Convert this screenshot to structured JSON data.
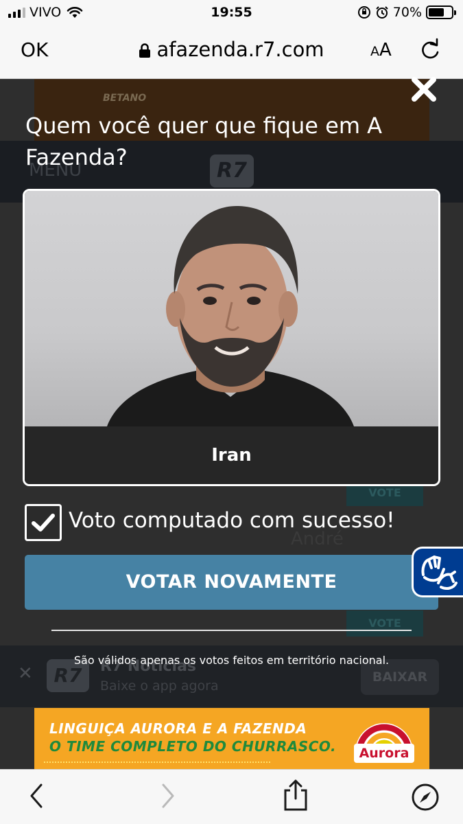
{
  "status_bar": {
    "carrier": "VIVO",
    "time": "19:55",
    "battery": "70%",
    "battery_level": 0.7
  },
  "browser": {
    "done_label": "OK",
    "url": "afazenda.r7.com",
    "text_size_label": "AA"
  },
  "background_page": {
    "top_ad_brand": "BETANO",
    "menu_label": "MENU",
    "site_logo": "R7",
    "vote_label": "VOTE",
    "candidate_name": "André",
    "app_banner": {
      "logo": "R7",
      "title": "R7 Notícias",
      "subtitle": "Baixe o app agora",
      "download_label": "BAIXAR"
    }
  },
  "ad_banner": {
    "line1": "LINGUIÇA AURORA E A FAZENDA",
    "line2": "O TIME COMPLETO DO CHURRASCO.",
    "brand": "Aurora"
  },
  "modal": {
    "title": "Quem você quer que fique em A Fazenda?",
    "candidate_name": "Iran",
    "confirmation": "Voto computado com sucesso!",
    "vote_again_label": "VOTAR NOVAMENTE",
    "disclaimer": "São válidos apenas os votos feitos em território nacional."
  },
  "colors": {
    "vote_button": "#4682a4",
    "overlay": "#2b2b2b",
    "accessibility_widget": "#003c91",
    "ad_background": "#f5a623"
  }
}
